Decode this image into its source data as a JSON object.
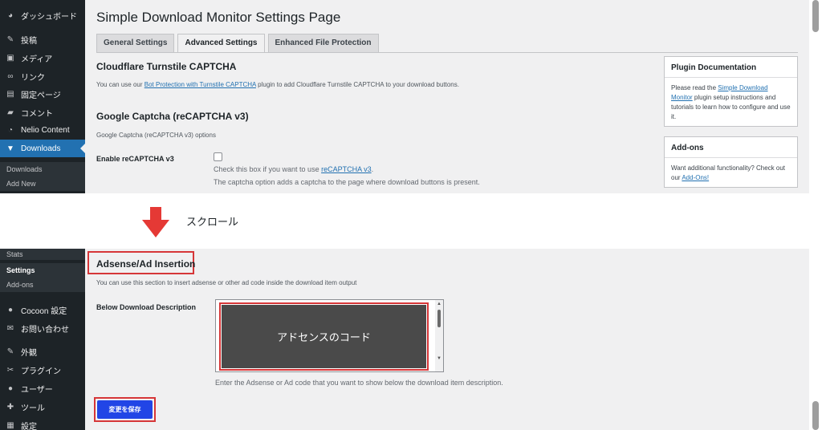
{
  "top_sidebar": {
    "items": [
      {
        "icon": "dashboard-icon",
        "glyph": "◕",
        "label": "ダッシュボード"
      },
      {
        "icon": "pin-icon",
        "glyph": "✎",
        "label": "投稿"
      },
      {
        "icon": "media-icon",
        "glyph": "▣",
        "label": "メディア"
      },
      {
        "icon": "link-icon",
        "glyph": "∞",
        "label": "リンク"
      },
      {
        "icon": "page-icon",
        "glyph": "▤",
        "label": "固定ページ"
      },
      {
        "icon": "comment-icon",
        "glyph": "▰",
        "label": "コメント"
      },
      {
        "icon": "nelio-icon",
        "glyph": "◔",
        "label": "Nelio Content"
      },
      {
        "icon": "download-icon",
        "glyph": "▼",
        "label": "Downloads"
      }
    ],
    "submenu": [
      "Downloads",
      "Add New"
    ]
  },
  "settings_page": {
    "title": "Simple Download Monitor Settings Page",
    "tabs": [
      "General Settings",
      "Advanced Settings",
      "Enhanced File Protection"
    ],
    "cloudflare": {
      "heading": "Cloudflare Turnstile CAPTCHA",
      "text_before": "You can use our ",
      "link": "Bot Protection with Turnstile CAPTCHA",
      "text_after": " plugin to add Cloudflare Turnstile CAPTCHA to your download buttons."
    },
    "google": {
      "heading": "Google Captcha (reCAPTCHA v3)",
      "subtext": "Google Captcha (reCAPTCHA v3) options",
      "field_label": "Enable reCAPTCHA v3",
      "help_before": "Check this box if you want to use ",
      "help_link": "reCAPTCHA v3",
      "help_after": ".",
      "help2": "The captcha option adds a captcha to the page where download buttons is present."
    },
    "plugin_doc": {
      "title": "Plugin Documentation",
      "body_before": "Please read the ",
      "body_link": "Simple Download Monitor",
      "body_after": " plugin setup instructions and tutorials to learn how to configure and use it."
    },
    "addons": {
      "title": "Add-ons",
      "body_before": "Want additional functionality? Check out our ",
      "body_link": "Add-Ons!"
    }
  },
  "scroll_note": {
    "label": "スクロール"
  },
  "bottom_sidebar": {
    "submenu": [
      "Stats",
      "Settings",
      "Add-ons"
    ],
    "items": [
      {
        "icon": "cocoon-icon",
        "glyph": "●",
        "label": "Cocoon 設定"
      },
      {
        "icon": "mail-icon",
        "glyph": "✉",
        "label": "お問い合わせ"
      },
      {
        "icon": "appearance-icon",
        "glyph": "✎",
        "label": "外観"
      },
      {
        "icon": "plugin-icon",
        "glyph": "✂",
        "label": "プラグイン"
      },
      {
        "icon": "user-icon",
        "glyph": "●",
        "label": "ユーザー"
      },
      {
        "icon": "tool-icon",
        "glyph": "✚",
        "label": "ツール"
      },
      {
        "icon": "settings-icon",
        "glyph": "▦",
        "label": "設定"
      }
    ]
  },
  "adsense": {
    "heading": "Adsense/Ad Insertion",
    "subtext": "You can use this section to insert adsense or other ad code inside the download item output",
    "field_label": "Below Download Description",
    "textarea_value": "アドセンスのコード",
    "help": "Enter the Adsense or Ad code that you want to show below the download item description.",
    "save_label": "変更を保存"
  },
  "colors": {
    "sidebar": "#1d2327",
    "active": "#2271b1",
    "highlight": "#d63638",
    "save": "#2145e6",
    "arrow": "#e53935"
  }
}
